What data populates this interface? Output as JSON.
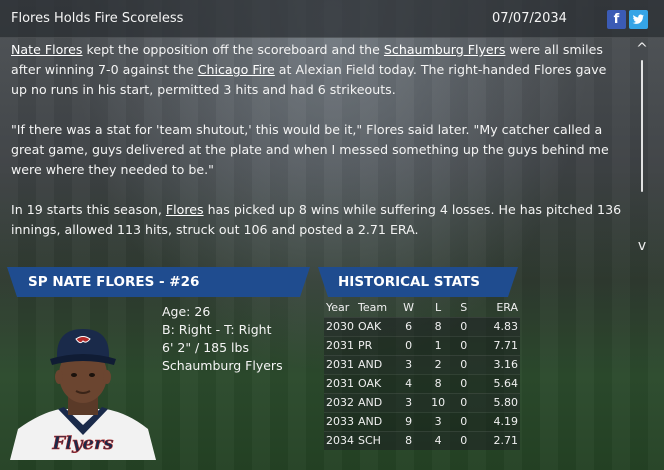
{
  "header": {
    "headline": "Flores Holds Fire Scoreless",
    "date": "07/07/2034",
    "facebook_icon": "f",
    "twitter_icon": "t"
  },
  "article": {
    "p1": {
      "link_pitcher": "Nate Flores",
      "t1": " kept the opposition off the scoreboard and the ",
      "link_team": "Schaumburg Flyers",
      "t2": " were all smiles after winning 7-0 against the ",
      "link_opponent": "Chicago Fire",
      "t3": " at Alexian Field today. The right-handed Flores gave up no runs in his start, permitted 3 hits and had 6 strikeouts."
    },
    "p2": "\"If there was a stat for 'team shutout,' this would be it,\" Flores said later. \"My catcher called a great game, guys delivered at the plate and when I messed something up the guys behind me were where they needed to be.\"",
    "p3": {
      "t1": "In 19 starts this season, ",
      "link_pitcher": "Flores",
      "t2": " has picked up 8 wins while suffering 4 losses. He has pitched 136 innings, allowed 113 hits, struck out 106 and posted a 2.71 ERA."
    }
  },
  "scroll": {
    "up": "^",
    "down": "v"
  },
  "player": {
    "banner": "SP NATE FLORES - #26",
    "age": "Age: 26",
    "bats_throws": "B: Right - T: Right",
    "size": "6' 2\" / 185 lbs",
    "team": "Schaumburg Flyers",
    "jersey_text": "Flyers",
    "colors": {
      "cap": "#1a2a4a",
      "jersey": "#f2f2f2",
      "accent": "#b22a2a"
    }
  },
  "stats": {
    "banner": "HISTORICAL STATS",
    "headers": {
      "year": "Year",
      "team": "Team",
      "w": "W",
      "l": "L",
      "s": "S",
      "era": "ERA"
    },
    "rows": [
      {
        "year": "2030",
        "team": "OAK",
        "w": "6",
        "l": "8",
        "s": "0",
        "era": "4.83"
      },
      {
        "year": "2031",
        "team": "PR",
        "w": "0",
        "l": "1",
        "s": "0",
        "era": "7.71"
      },
      {
        "year": "2031",
        "team": "AND",
        "w": "3",
        "l": "2",
        "s": "0",
        "era": "3.16"
      },
      {
        "year": "2031",
        "team": "OAK",
        "w": "4",
        "l": "8",
        "s": "0",
        "era": "5.64"
      },
      {
        "year": "2032",
        "team": "AND",
        "w": "3",
        "l": "10",
        "s": "0",
        "era": "5.80"
      },
      {
        "year": "2033",
        "team": "AND",
        "w": "9",
        "l": "3",
        "s": "0",
        "era": "4.19"
      },
      {
        "year": "2034",
        "team": "SCH",
        "w": "8",
        "l": "4",
        "s": "0",
        "era": "2.71"
      }
    ]
  },
  "colors": {
    "banner": "#1f4c8f",
    "facebook": "#3b5bb5",
    "twitter": "#35a4e6"
  }
}
